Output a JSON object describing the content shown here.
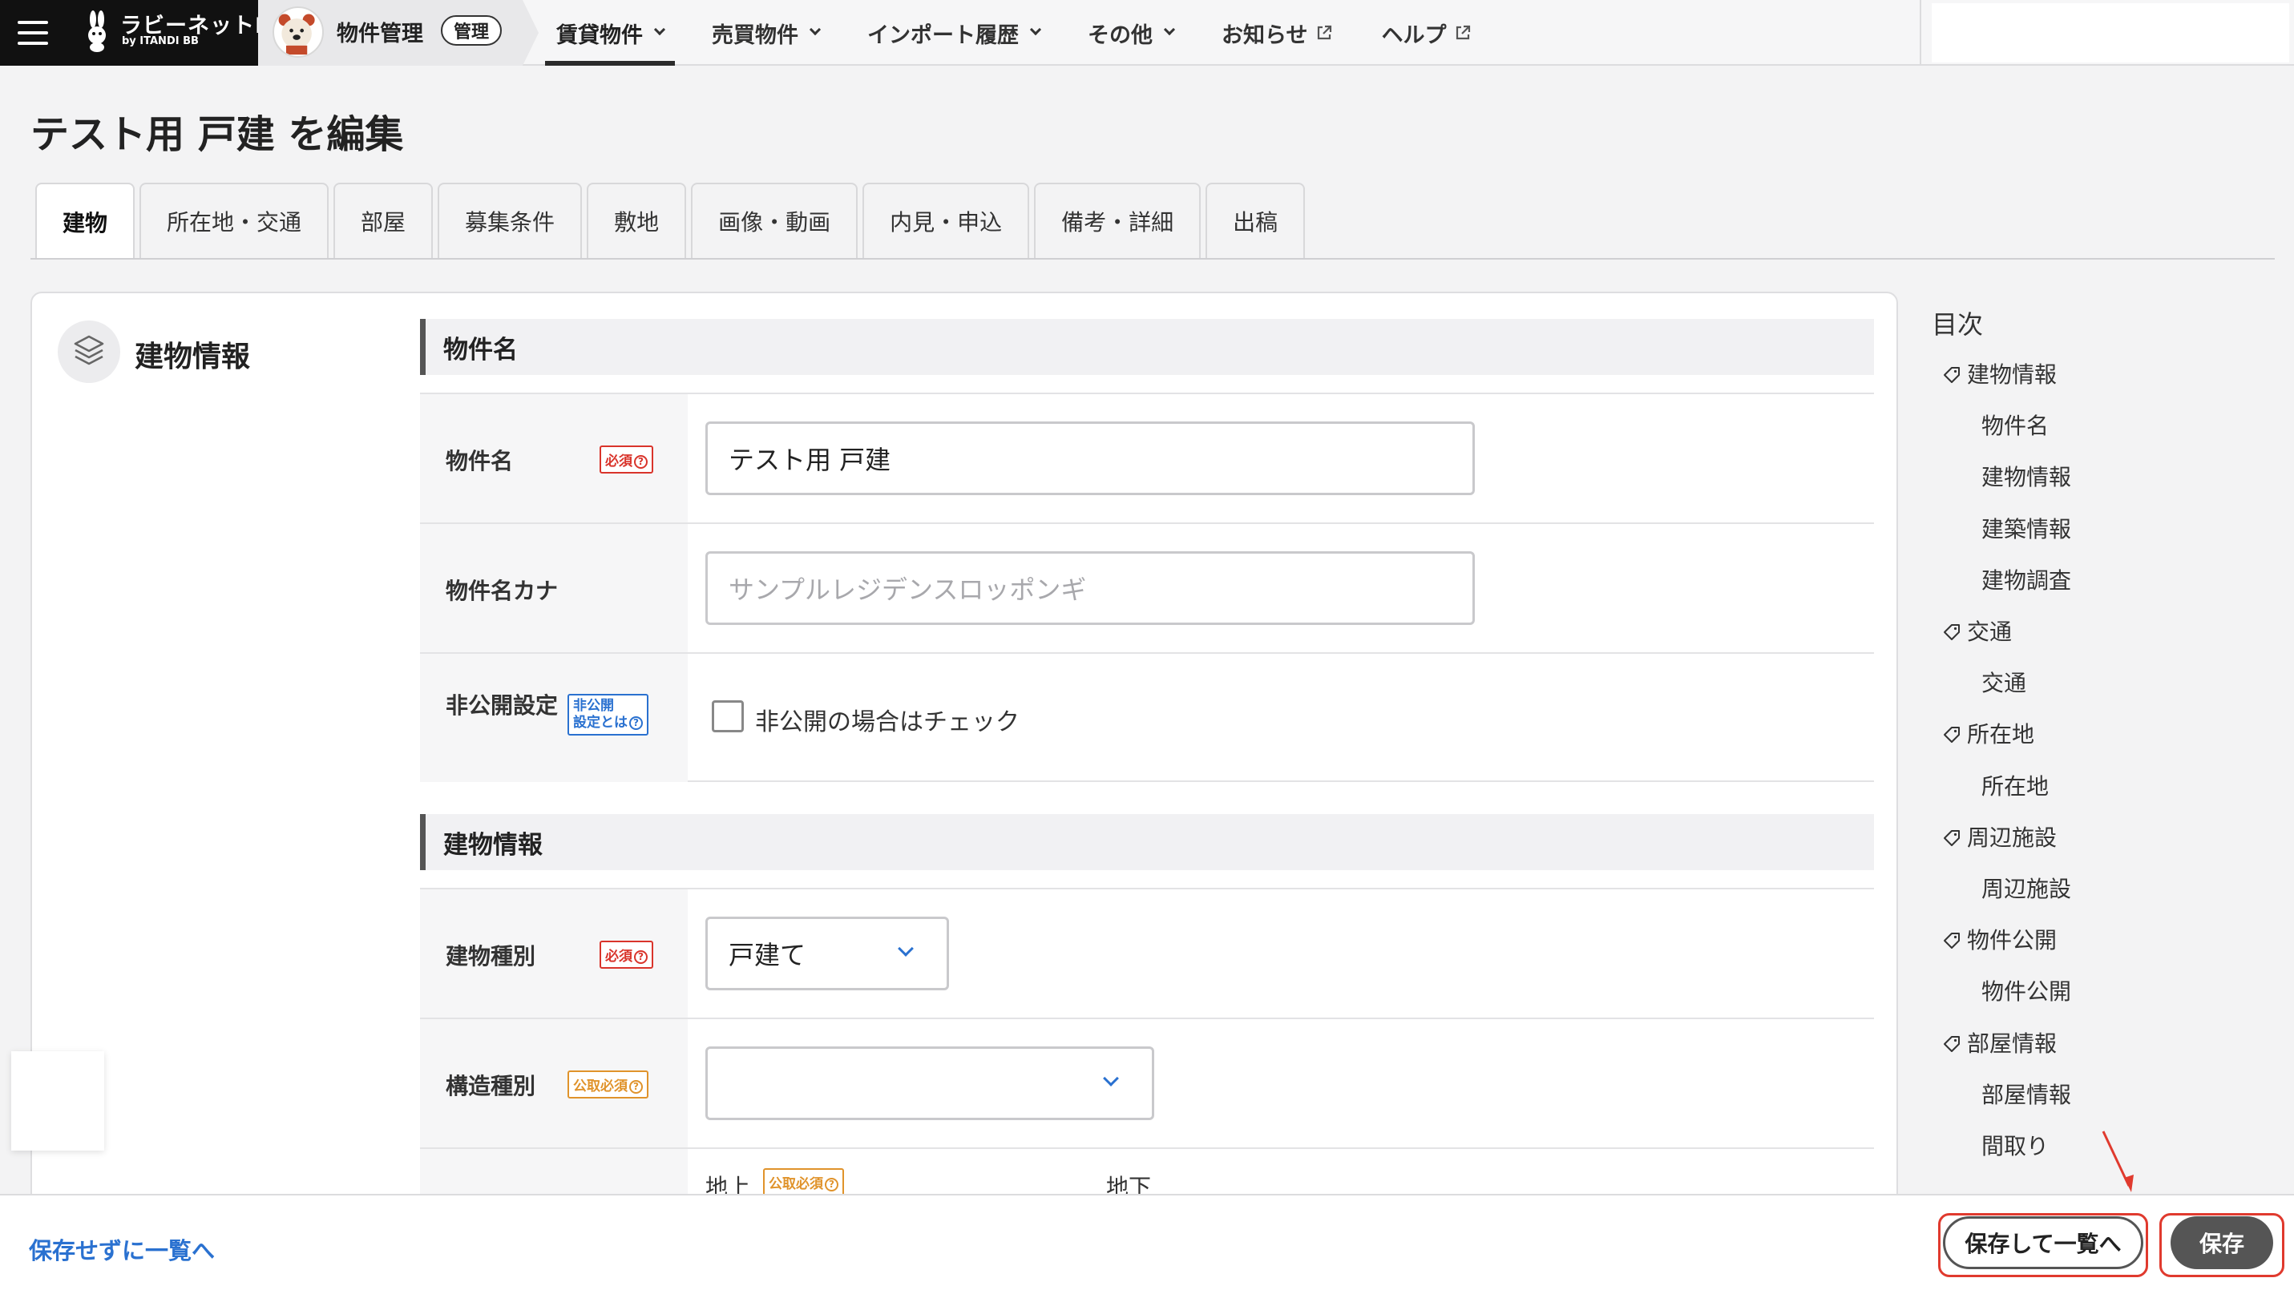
{
  "header": {
    "brand": "ラビーネットBB",
    "brand_sub": "by ITANDI BB",
    "app_title": "物件管理",
    "app_badge": "管理",
    "nav": [
      {
        "label": "賃貸物件",
        "dropdown": true,
        "active": true
      },
      {
        "label": "売買物件",
        "dropdown": true
      },
      {
        "label": "インポート履歴",
        "dropdown": true
      },
      {
        "label": "その他",
        "dropdown": true
      },
      {
        "label": "お知らせ",
        "external": true
      },
      {
        "label": "ヘルプ",
        "external": true
      }
    ]
  },
  "page": {
    "title": "テスト用 戸建 を編集",
    "tabs": [
      "建物",
      "所在地・交通",
      "部屋",
      "募集条件",
      "敷地",
      "画像・動画",
      "内見・申込",
      "備考・詳細",
      "出稿"
    ]
  },
  "section": {
    "title": "建物情報",
    "groups": [
      {
        "title": "物件名"
      },
      {
        "title": "建物情報"
      }
    ],
    "fields": {
      "name": {
        "label": "物件名",
        "badge": "必須",
        "value": "テスト用 戸建"
      },
      "kana": {
        "label": "物件名カナ",
        "placeholder": "サンプルレジデンスロッポンギ"
      },
      "private": {
        "label": "非公開設定",
        "badge_line1": "非公開",
        "badge_line2": "設定とは",
        "checkbox_label": "非公開の場合はチェック",
        "checked": false
      },
      "building_type": {
        "label": "建物種別",
        "badge": "必須",
        "value": "戸建て"
      },
      "structure_type": {
        "label": "構造種別",
        "badge": "公取必須",
        "value": ""
      },
      "floors": {
        "above_label": "地上",
        "above_badge": "公取必須",
        "below_label": "地下"
      }
    }
  },
  "toc": {
    "title": "目次",
    "items": [
      {
        "label": "建物情報",
        "level": 1
      },
      {
        "label": "物件名",
        "level": 2
      },
      {
        "label": "建物情報",
        "level": 2
      },
      {
        "label": "建築情報",
        "level": 2
      },
      {
        "label": "建物調査",
        "level": 2
      },
      {
        "label": "交通",
        "level": 1
      },
      {
        "label": "交通",
        "level": 2
      },
      {
        "label": "所在地",
        "level": 1
      },
      {
        "label": "所在地",
        "level": 2
      },
      {
        "label": "周辺施設",
        "level": 1
      },
      {
        "label": "周辺施設",
        "level": 2
      },
      {
        "label": "物件公開",
        "level": 1
      },
      {
        "label": "物件公開",
        "level": 2
      },
      {
        "label": "部屋情報",
        "level": 1
      },
      {
        "label": "部屋情報",
        "level": 2
      },
      {
        "label": "間取り",
        "level": 2
      }
    ]
  },
  "footer": {
    "back_link": "保存せずに一覧へ",
    "save_and_list": "保存して一覧へ",
    "save": "保存"
  },
  "colors": {
    "accent_blue": "#2a71d0",
    "required_red": "#d9342b",
    "public_orange": "#e0932b",
    "annotation_red": "#e03a2e",
    "primary_button": "#555555"
  }
}
